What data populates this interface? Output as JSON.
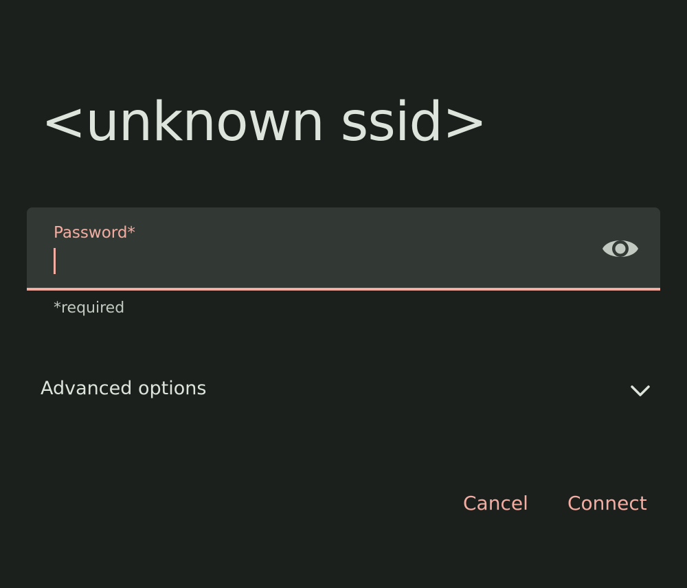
{
  "dialog": {
    "title": "<unknown ssid>",
    "password_field": {
      "label": "Password*",
      "value": "",
      "helper": "*required",
      "toggle_icon": "eye-icon"
    },
    "advanced": {
      "label": "Advanced options",
      "icon": "chevron-down-icon"
    },
    "buttons": {
      "cancel": "Cancel",
      "connect": "Connect"
    }
  },
  "colors": {
    "background": "#1b201d",
    "field_background": "#323833",
    "accent": "#f4ada2",
    "text_primary": "#dde4dc",
    "text_secondary": "#c1c9c0"
  }
}
